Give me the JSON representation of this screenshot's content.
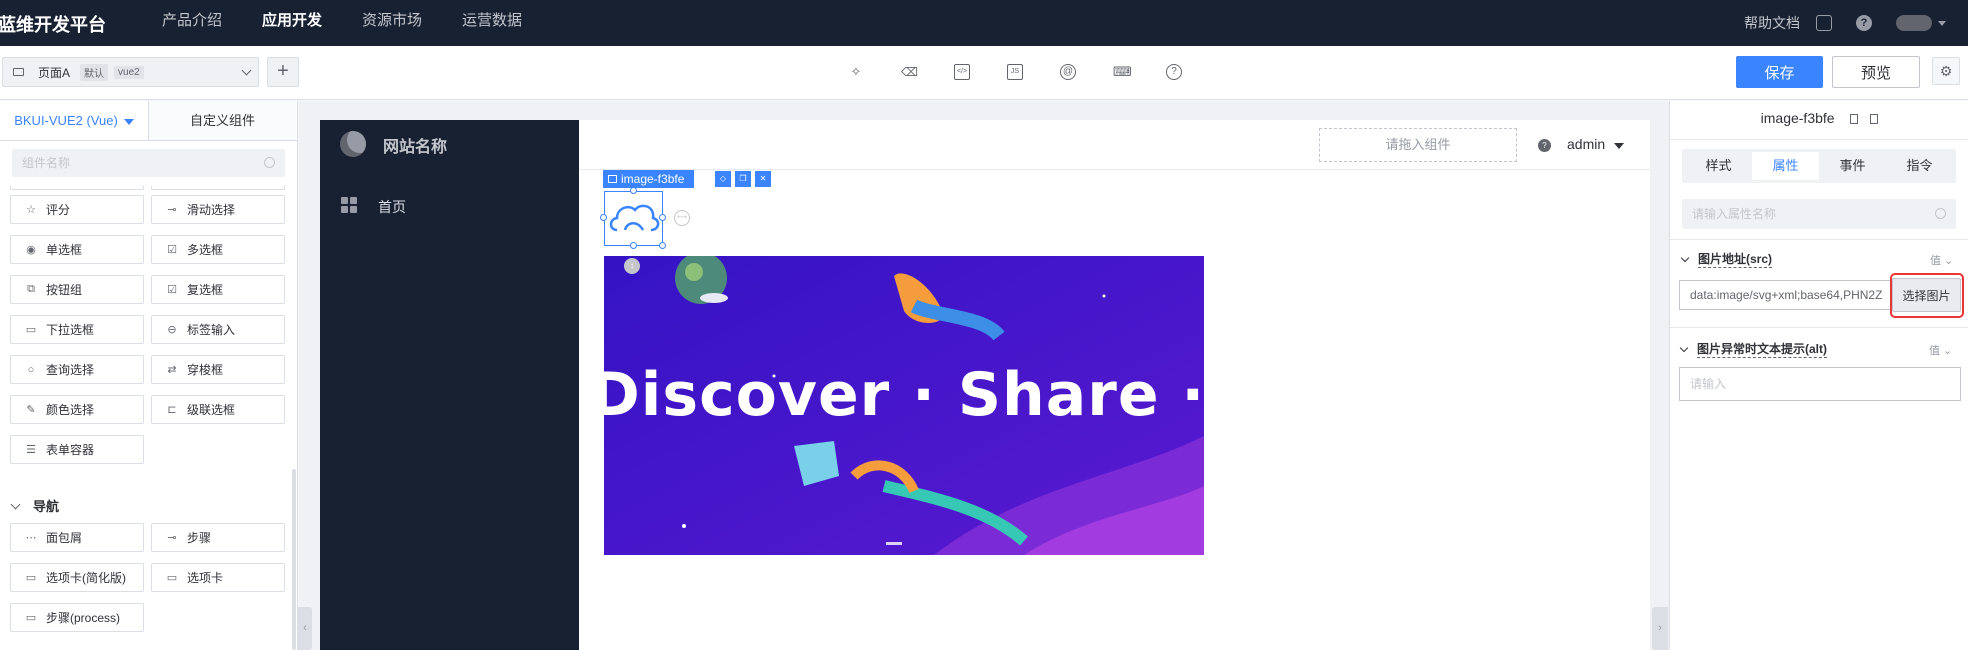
{
  "topnav": {
    "brand": "蓝维开发平台",
    "links": [
      "产品介绍",
      "应用开发",
      "资源市场",
      "运营数据"
    ],
    "active_link": "应用开发",
    "help": "帮助文档"
  },
  "toolbar": {
    "page_name": "页面A",
    "page_tag_default": "默认",
    "page_tag_vue": "vue2",
    "add_label": "+",
    "tools": [
      "puzzle-icon",
      "trash-icon",
      "code-icon",
      "js-icon",
      "at-icon",
      "keyboard-icon",
      "help-icon"
    ],
    "tool_glyphs": [
      "✧",
      "🗑",
      "</>",
      "JS",
      "@",
      "⌨",
      "?"
    ],
    "save_label": "保存",
    "preview_label": "预览"
  },
  "library": {
    "tab_vue": "BKUI-VUE2 (Vue)",
    "tab_custom": "自定义组件",
    "search_placeholder": "组件名称",
    "form_components": [
      {
        "icon": "☆",
        "label": "评分"
      },
      {
        "icon": "⊸",
        "label": "滑动选择"
      },
      {
        "icon": "◉",
        "label": "单选框"
      },
      {
        "icon": "☑",
        "label": "多选框"
      },
      {
        "icon": "⧉",
        "label": "按钮组"
      },
      {
        "icon": "☑",
        "label": "复选框"
      },
      {
        "icon": "▭",
        "label": "下拉选框"
      },
      {
        "icon": "⊖",
        "label": "标签输入"
      },
      {
        "icon": "○",
        "label": "查询选择"
      },
      {
        "icon": "⇄",
        "label": "穿梭框"
      },
      {
        "icon": "✎",
        "label": "颜色选择"
      },
      {
        "icon": "⊏",
        "label": "级联选框"
      },
      {
        "icon": "☰",
        "label": "表单容器"
      }
    ],
    "nav_group_title": "导航",
    "nav_components": [
      {
        "icon": "⋯",
        "label": "面包屑"
      },
      {
        "icon": "⊸",
        "label": "步骤"
      },
      {
        "icon": "▭",
        "label": "选项卡(简化版)"
      },
      {
        "icon": "▭",
        "label": "选项卡"
      },
      {
        "icon": "▭",
        "label": "步骤(process)"
      }
    ]
  },
  "canvas": {
    "site_name": "网站名称",
    "menu_home": "首页",
    "drop_slot": "请拖入组件",
    "user": "admin",
    "selected_component": "image-f3bfe",
    "banner_text": "Discover · Share · Enjoy"
  },
  "props_panel": {
    "component_id": "image-f3bfe",
    "tabs": [
      "样式",
      "属性",
      "事件",
      "指令"
    ],
    "active_tab": "属性",
    "search_placeholder": "请输入属性名称",
    "src_title": "图片地址(src)",
    "src_value_tag": "值",
    "src_value": "data:image/svg+xml;base64,PHN2Z",
    "choose_image": "选择图片",
    "alt_title": "图片异常时文本提示(alt)",
    "alt_value_tag": "值",
    "alt_placeholder": "请输入"
  },
  "colors": {
    "topnav_bg": "#182132",
    "primary": "#3a84ff",
    "highlight_ring": "#ea3636",
    "banner_bg": "#3a14c6"
  }
}
